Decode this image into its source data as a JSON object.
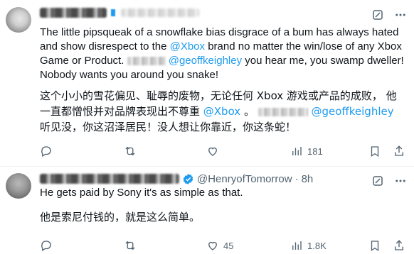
{
  "tweets": [
    {
      "author_name": "",
      "handle": "",
      "time": "",
      "text_en_1": "The little pipsqueak of a snowflake bias disgrace of a bum has always hated and show disrespect to the ",
      "mention_xbox": "@Xbox",
      "text_en_2": " brand no matter the win/lose of any Xbox Game or Product. ",
      "mention_geoff": "@geoffkeighley",
      "text_en_3": " you hear me, you swamp dweller! Nobody wants you around you snake!",
      "text_zh_1": "这个小小的雪花偏见、耻辱的废物，无论任何 Xbox 游戏或产品的成败， 他一直都憎恨并对品牌表现出不尊重 ",
      "mention_xbox_zh": "@Xbox",
      "text_zh_2": " 。 ",
      "mention_geoff_zh": "@geoffkeighley",
      "text_zh_3": " 听见没，你这沼泽居民！没人想让你靠近，你这条蛇！",
      "stats": {
        "replies": "",
        "retweets": "",
        "likes": "",
        "views": "181"
      }
    },
    {
      "author_name": "",
      "handle": "@HenryofTomorrow",
      "separator": "·",
      "time": "8h",
      "text_en": "He gets paid by Sony it's as simple as that.",
      "text_zh": "他是索尼付钱的，就是这么简单。",
      "stats": {
        "replies": "",
        "retweets": "",
        "likes": "45",
        "views": "1.8K"
      }
    }
  ],
  "colors": {
    "accent": "#1d9bf0",
    "text": "#0f1419",
    "secondary": "#536471",
    "divider": "#eff3f4",
    "verified": "#1d9bf0"
  },
  "icons": {
    "top": [
      "grok-icon",
      "more-icon"
    ],
    "actions": [
      "reply-icon",
      "retweet-icon",
      "like-icon",
      "views-icon",
      "bookmark-icon",
      "share-icon"
    ]
  }
}
